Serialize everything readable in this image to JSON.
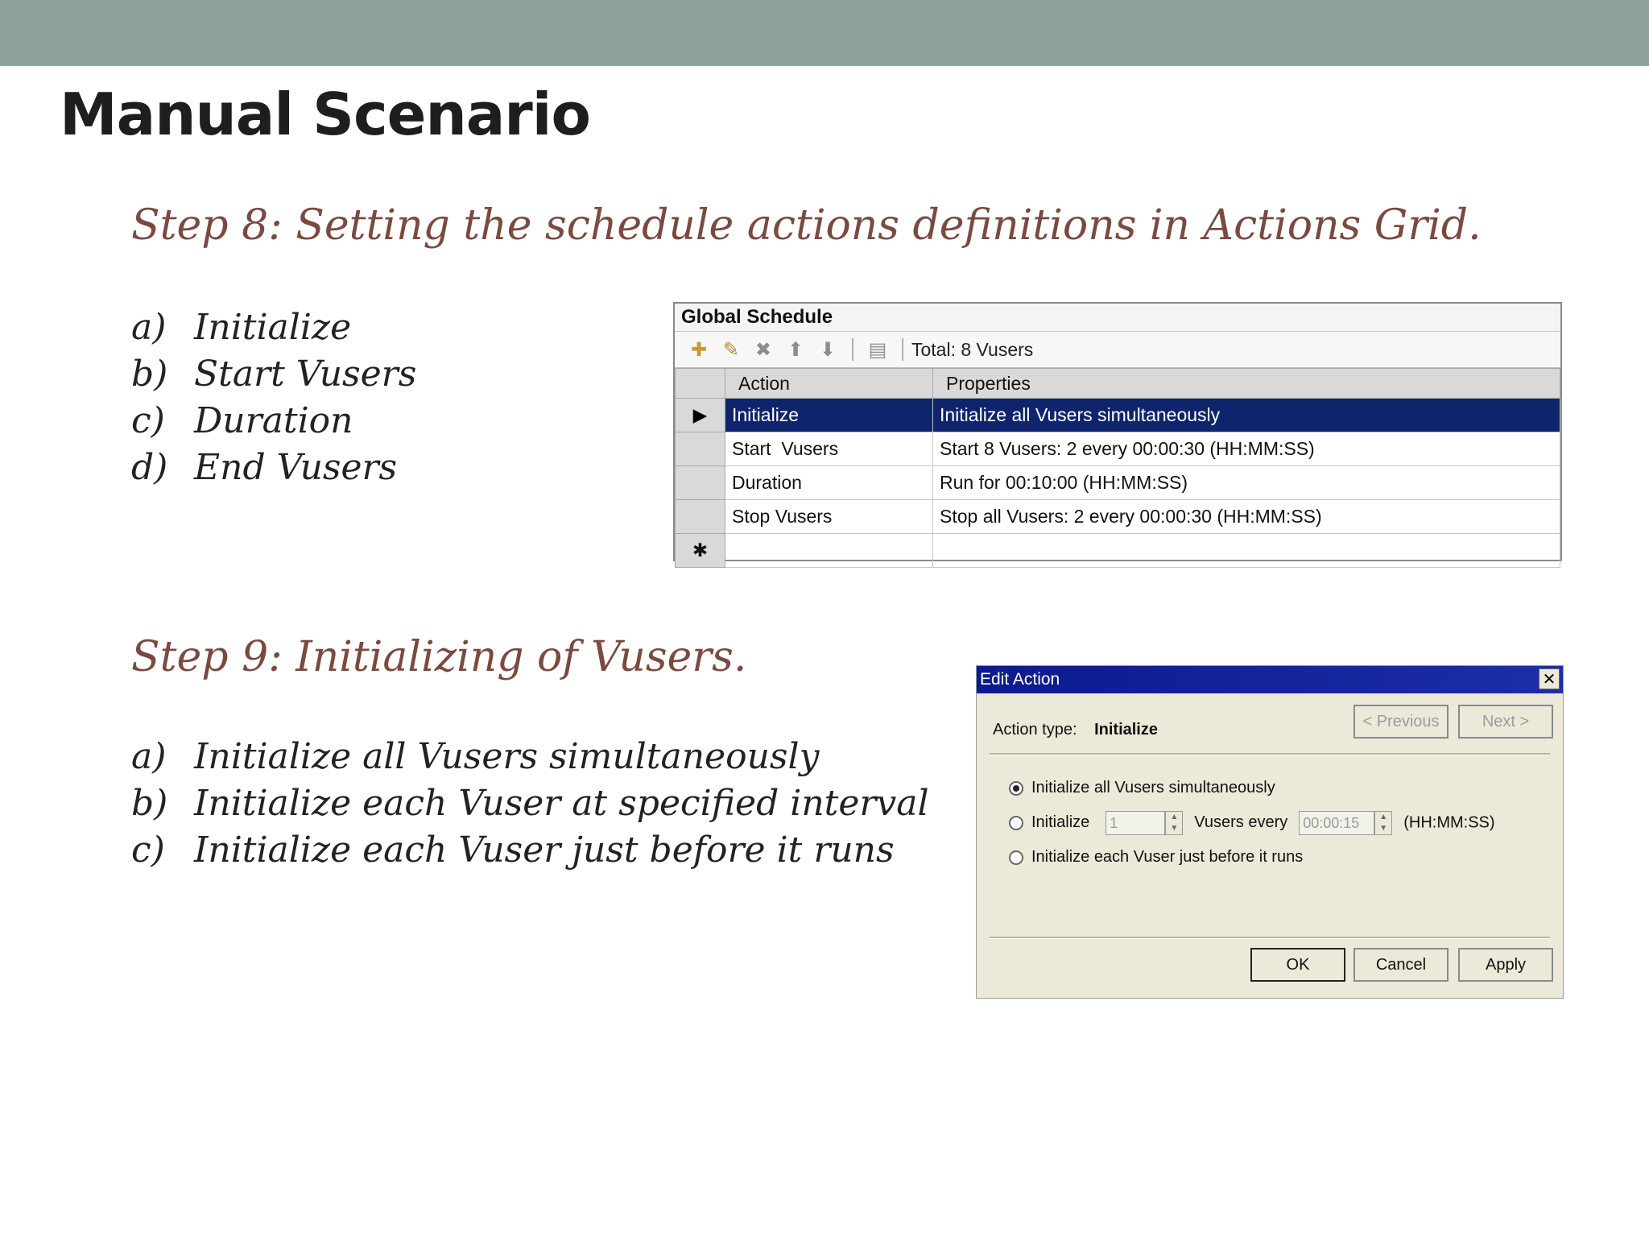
{
  "slide": {
    "title": "Manual Scenario",
    "step8": {
      "heading": "Step 8: Setting the schedule actions definitions in Actions Grid.",
      "items": [
        {
          "marker": "a)",
          "text": "Initialize"
        },
        {
          "marker": "b)",
          "text": "Start Vusers"
        },
        {
          "marker": "c)",
          "text": "Duration"
        },
        {
          "marker": "d)",
          "text": "End Vusers"
        }
      ]
    },
    "step9": {
      "heading": "Step 9: Initializing of Vusers.",
      "items": [
        {
          "marker": "a)",
          "text": "Initialize all Vusers simultaneously"
        },
        {
          "marker": "b)",
          "text": "Initialize each Vuser at specified interval"
        },
        {
          "marker": "c)",
          "text": "Initialize each Vuser just before it runs"
        }
      ]
    }
  },
  "global_schedule": {
    "title": "Global Schedule",
    "toolbar": {
      "icons": [
        "new-action-icon",
        "edit-action-icon",
        "delete-action-icon",
        "move-up-icon",
        "move-down-icon",
        "copy-icon"
      ],
      "total": "Total: 8 Vusers"
    },
    "columns": {
      "action": "Action",
      "properties": "Properties"
    },
    "rows": [
      {
        "action": "Initialize",
        "properties": "Initialize all Vusers simultaneously",
        "selected": true
      },
      {
        "action": "Start  Vusers",
        "properties": "Start 8 Vusers: 2 every 00:00:30 (HH:MM:SS)"
      },
      {
        "action": "Duration",
        "properties": "Run for 00:10:00 (HH:MM:SS)"
      },
      {
        "action": "Stop Vusers",
        "properties": "Stop all Vusers: 2 every 00:00:30 (HH:MM:SS)"
      }
    ],
    "new_row_marker": "✱",
    "selected_marker": "▶"
  },
  "edit_action": {
    "title": "Edit Action",
    "close": "✕",
    "action_type_label": "Action type:",
    "action_type_value": "Initialize",
    "previous": "< Previous",
    "next": "Next >",
    "option1": "Initialize all Vusers simultaneously",
    "option2_prefix": "Initialize",
    "option2_count": "1",
    "option2_mid": "Vusers every",
    "option2_interval": "00:00:15",
    "option2_unit": "(HH:MM:SS)",
    "option3": "Initialize each Vuser just before it runs",
    "ok": "OK",
    "cancel": "Cancel",
    "apply": "Apply",
    "colors": {
      "titlebar": "#0b1a8c",
      "selection": "#0e246c"
    }
  }
}
